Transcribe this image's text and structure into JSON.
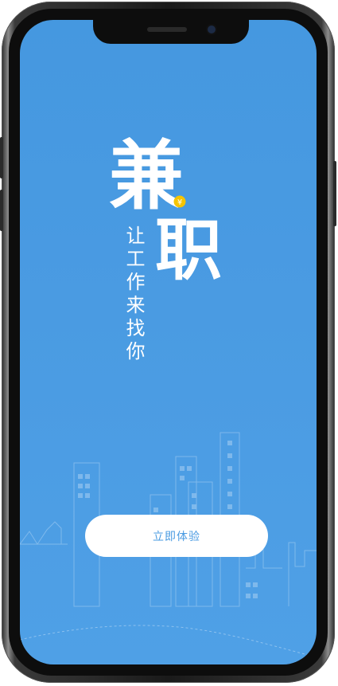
{
  "app": {
    "logo": {
      "char_top": "兼",
      "char_bottom": "职",
      "coin_icon": "yen-coin-icon"
    },
    "slogan": "让工作来找你",
    "start_button": {
      "label": "立即体验"
    }
  },
  "colors": {
    "background": "#4a9be2",
    "button_bg": "#ffffff",
    "button_text": "#4a9be2",
    "coin": "#f5c400",
    "city_lines": "#8fc2ef"
  }
}
